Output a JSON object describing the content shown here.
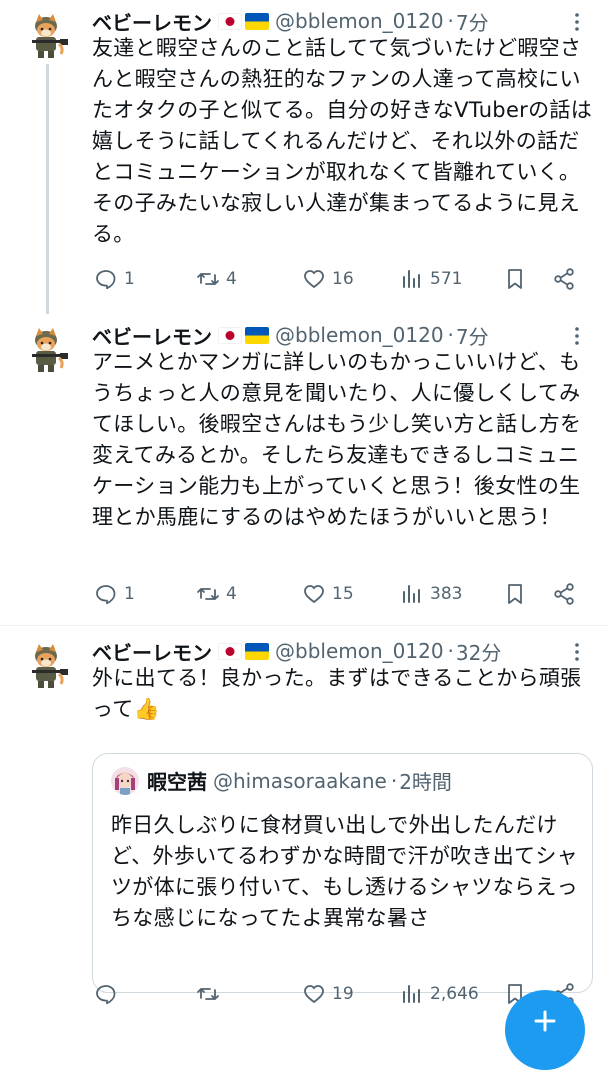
{
  "tweets": [
    {
      "name": "ベビーレモン",
      "handle": "@bblemon_0120",
      "time": "7分",
      "text": "友達と暇空さんのこと話してて気づいたけど暇空さんと暇空さんの熱狂的なファンの人達って高校にいたオタクの子と似てる。自分の好きなVTuberの話は嬉しそうに話してくれるんだけど、それ以外の話だとコミュニケーションが取れなくて皆離れていく。その子みたいな寂しい人達が集まってるように見える。",
      "replies": "1",
      "retweets": "4",
      "likes": "16",
      "views": "571"
    },
    {
      "name": "ベビーレモン",
      "handle": "@bblemon_0120",
      "time": "7分",
      "text": "アニメとかマンガに詳しいのもかっこいいけど、もうちょっと人の意見を聞いたり、人に優しくしてみてほしい。後暇空さんはもう少し笑い方と話し方を変えてみるとか。そしたら友達もできるしコミュニケーション能力も上がっていくと思う！後女性の生理とか馬鹿にするのはやめたほうがいいと思う！",
      "replies": "1",
      "retweets": "4",
      "likes": "15",
      "views": "383"
    },
    {
      "name": "ベビーレモン",
      "handle": "@bblemon_0120",
      "time": "32分",
      "text": "外に出てる！良かった。まずはできることから頑張って👍",
      "replies": "",
      "retweets": "",
      "likes": "19",
      "views": "2,646",
      "quote": {
        "name": "暇空茜",
        "handle": "@himasoraakane",
        "time": "2時間",
        "text": "昨日久しぶりに食材買い出しで外出したんだけど、外歩いてるわずかな時間で汗が吹き出てシャツが体に張り付いて、もし透けるシャツならえっちな感じになってたよ異常な暑さ"
      }
    }
  ],
  "separator": "·",
  "colors": {
    "text": "#0f1419",
    "secondary": "#536471",
    "accent": "#1d9bf0",
    "border": "#cfd9de"
  },
  "icons": [
    "reply-icon",
    "retweet-icon",
    "like-icon",
    "views-icon",
    "bookmark-icon",
    "share-icon",
    "more-icon",
    "compose-icon"
  ]
}
